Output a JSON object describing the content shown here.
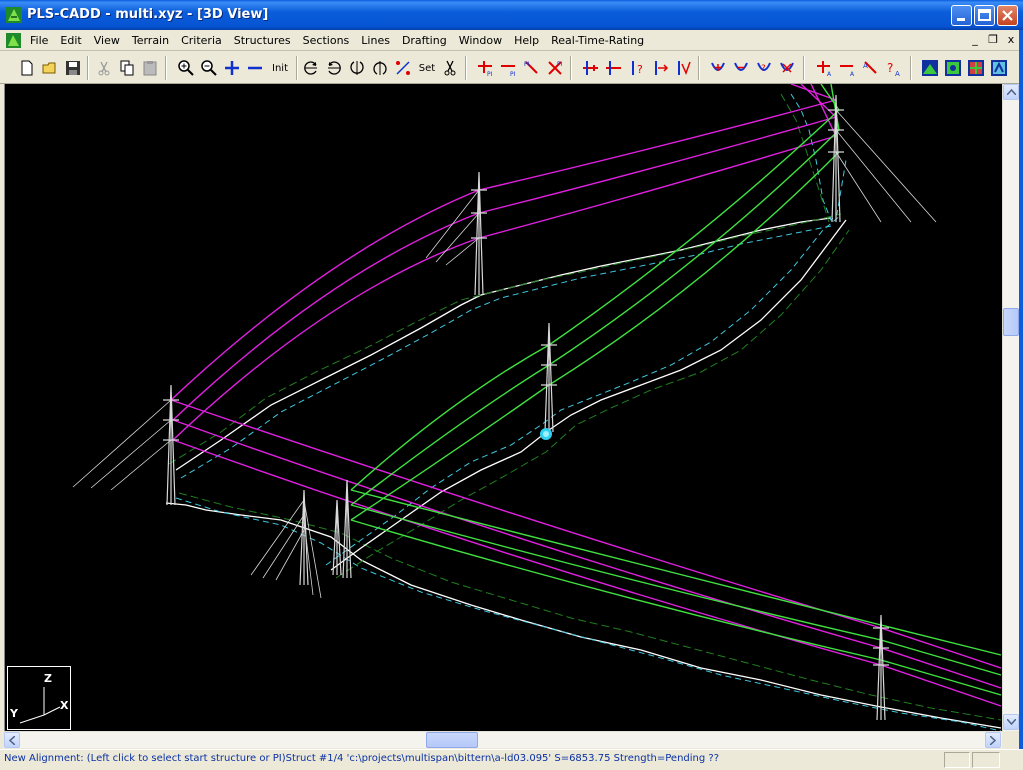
{
  "window": {
    "title": "PLS-CADD - multi.xyz - [3D View]",
    "app_icon": "pls-cadd-icon",
    "controls": [
      "minimize-icon",
      "maximize-icon",
      "close-icon"
    ]
  },
  "menu": {
    "items": [
      {
        "label": "File"
      },
      {
        "label": "Edit"
      },
      {
        "label": "View"
      },
      {
        "label": "Terrain"
      },
      {
        "label": "Criteria"
      },
      {
        "label": "Structures"
      },
      {
        "label": "Sections"
      },
      {
        "label": "Lines"
      },
      {
        "label": "Drafting"
      },
      {
        "label": "Window"
      },
      {
        "label": "Help"
      },
      {
        "label": "Real-Time-Rating"
      }
    ],
    "mdi_controls": {
      "minimize": "_",
      "restore": "❐",
      "close": "x"
    }
  },
  "toolbar": {
    "init_label": "Init",
    "set_label": "Set",
    "buttons": [
      "new-icon",
      "open-icon",
      "save-icon",
      "cut-icon",
      "copy-icon",
      "paste-icon",
      "zoom-in-icon",
      "zoom-out-icon",
      "pan-plus-icon",
      "pan-minus-icon",
      "init-view-button",
      "rotate-left-icon",
      "rotate-right-icon",
      "rotate-up-icon",
      "rotate-down-icon",
      "rotate-free-icon",
      "set-view-button",
      "scissors-icon",
      "add-pi-icon",
      "delete-pi-icon",
      "move-pi-icon",
      "remove-pi-icon",
      "add-structure-icon",
      "delete-structure-icon",
      "structure-info-icon",
      "move-structure-icon",
      "replace-structure-icon",
      "sag-icon-1",
      "sag-icon-2",
      "sag-icon-3",
      "sag-icon-4",
      "attach-icon-1",
      "attach-icon-2",
      "attach-icon-3",
      "attach-icon-4",
      "view-icon-1",
      "view-icon-2",
      "view-icon-3",
      "view-icon-4"
    ]
  },
  "axes": {
    "z": "Z",
    "y": "Y",
    "x": "X"
  },
  "colors": {
    "background": "#000000",
    "circuit_a": "#e020e0",
    "circuit_b": "#40e040",
    "terrain": "#ffffff",
    "terrain_offset_a": "#40c8e0",
    "terrain_offset_b": "#208020",
    "structure": "#d8d8d8",
    "selection_marker": "#30d0f0"
  },
  "status": {
    "message": "New Alignment: (Left click to select start structure or PI)Struct #1/4 'c:\\projects\\multispan\\bittern\\a-ld03.095' S=6853.75 Strength=Pending  ??"
  }
}
